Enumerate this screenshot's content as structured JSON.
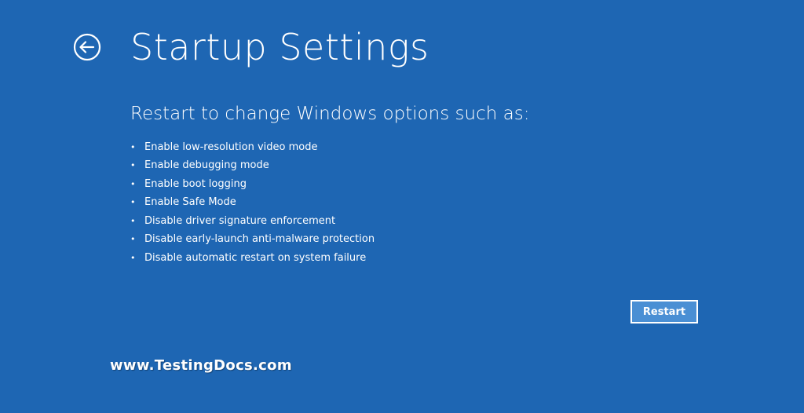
{
  "colors": {
    "background": "#1e66b3",
    "text": "#ffffff",
    "button_fill": "#4a8fd4",
    "button_border": "#ffffff"
  },
  "header": {
    "back_icon": "back-arrow-icon",
    "title": "Startup Settings"
  },
  "main": {
    "subtitle": "Restart to change Windows options such as:",
    "bullet_glyph": "•",
    "options": [
      "Enable low-resolution video mode",
      "Enable debugging mode",
      "Enable boot logging",
      "Enable Safe Mode",
      "Disable driver signature enforcement",
      "Disable early-launch anti-malware protection",
      "Disable automatic restart on system failure"
    ],
    "restart_label": "Restart"
  },
  "watermark": "www.TestingDocs.com"
}
